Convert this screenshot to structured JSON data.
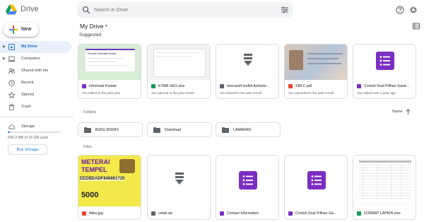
{
  "header": {
    "app_name": "Drive",
    "search_placeholder": "Search in Drive"
  },
  "sidebar": {
    "new_label": "New",
    "items": [
      {
        "label": "My Drive",
        "icon": "my-drive-icon",
        "active": true,
        "caret": true
      },
      {
        "label": "Computers",
        "icon": "computers-icon",
        "active": false,
        "caret": true
      },
      {
        "label": "Shared with me",
        "icon": "shared-icon",
        "active": false,
        "caret": false
      },
      {
        "label": "Recent",
        "icon": "clock-icon",
        "active": false,
        "caret": false
      },
      {
        "label": "Starred",
        "icon": "star-icon",
        "active": false,
        "caret": false
      },
      {
        "label": "Trash",
        "icon": "trash-icon",
        "active": false,
        "caret": false
      }
    ],
    "storage": {
      "label": "Storage",
      "usage_text": "646.3 MB of 15 GB used",
      "fraction": 0.043,
      "buy_label": "Buy storage"
    }
  },
  "main": {
    "title": "My Drive",
    "suggested_label": "Suggested",
    "folders_label": "Folders",
    "files_label": "Files",
    "sort_label": "Name",
    "suggested": [
      {
        "name": "Informasi Kontak",
        "sub": "You edited in the past year",
        "type": "form"
      },
      {
        "name": "KITAB SEO.xlsx",
        "sub": "You opened in the past month",
        "type": "sheet"
      },
      {
        "name": "microsoft toolkit Activato...",
        "sub": "You shared in the past month",
        "type": "archive"
      },
      {
        "name": "SIM C.pdf",
        "sub": "You uploaded in the past month",
        "type": "pdf"
      },
      {
        "name": "Contoh Soal Pilihan Gand...",
        "sub": "You edited over a year ago",
        "type": "form"
      }
    ],
    "folders": [
      {
        "name": "BUKU BISNIS"
      },
      {
        "name": "Download"
      },
      {
        "name": "LAMARAN"
      }
    ],
    "files": [
      {
        "name": "Akku.jpg",
        "type": "image"
      },
      {
        "name": "cetak.rar",
        "type": "archive"
      },
      {
        "name": "Contact Information",
        "type": "form"
      },
      {
        "name": "Contoh Soal Pilihan Ga...",
        "type": "form"
      },
      {
        "name": "FORMAT LAPKIN.xlsx",
        "type": "sheet"
      }
    ],
    "thumbnail_text": {
      "meterai": "METERAI",
      "tempel": "TEMPEL",
      "code": "EEDBDADF846661720",
      "amount": "5000",
      "form_title": "Formulir Informasi Kontak"
    }
  },
  "colors": {
    "accent": "#1a73e8",
    "active_bg": "#e8f0fe",
    "form": "#7b2ec2",
    "sheet": "#0f9d58",
    "pdf": "#ea4335",
    "archive": "#5f6368"
  }
}
